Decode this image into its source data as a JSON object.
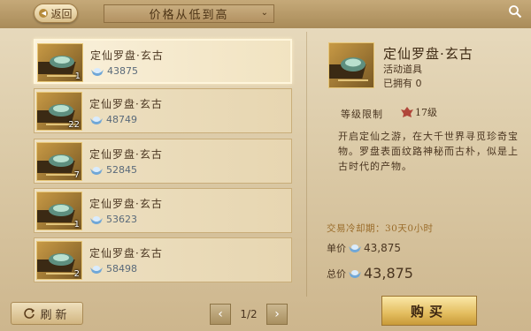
{
  "header": {
    "back_label": "返回",
    "sort_label": "价格从低到高"
  },
  "list": [
    {
      "name": "定仙罗盘·玄古",
      "count": "1",
      "price": "43875",
      "selected": true
    },
    {
      "name": "定仙罗盘·玄古",
      "count": "22",
      "price": "48749"
    },
    {
      "name": "定仙罗盘·玄古",
      "count": "7",
      "price": "52845"
    },
    {
      "name": "定仙罗盘·玄古",
      "count": "1",
      "price": "53623"
    },
    {
      "name": "定仙罗盘·玄古",
      "count": "2",
      "price": "58498"
    }
  ],
  "footer": {
    "refresh_label": "刷新",
    "page_indicator": "1/2"
  },
  "detail": {
    "name": "定仙罗盘·玄古",
    "type": "活动道具",
    "owned_label": "已拥有",
    "owned_value": "0",
    "level_label": "等级限制",
    "level_value": "17级",
    "description": "开启定仙之游，在大千世界寻觅珍奇宝物。罗盘表面纹路神秘而古朴，似是上古时代的产物。",
    "cooldown": "交易冷却期：30天0小时",
    "unit_price_label": "单价",
    "unit_price": "43,875",
    "total_price_label": "总价",
    "total_price": "43,875",
    "buy_label": "购买"
  },
  "colors": {
    "accent_gold": "#e3bd5f",
    "cooldown_text": "#9a6c2a"
  },
  "icons": {
    "currency": "silver-ingot-icon",
    "search": "search-icon",
    "back": "back-arrow-icon",
    "refresh": "refresh-icon",
    "level": "level-badge-icon"
  }
}
